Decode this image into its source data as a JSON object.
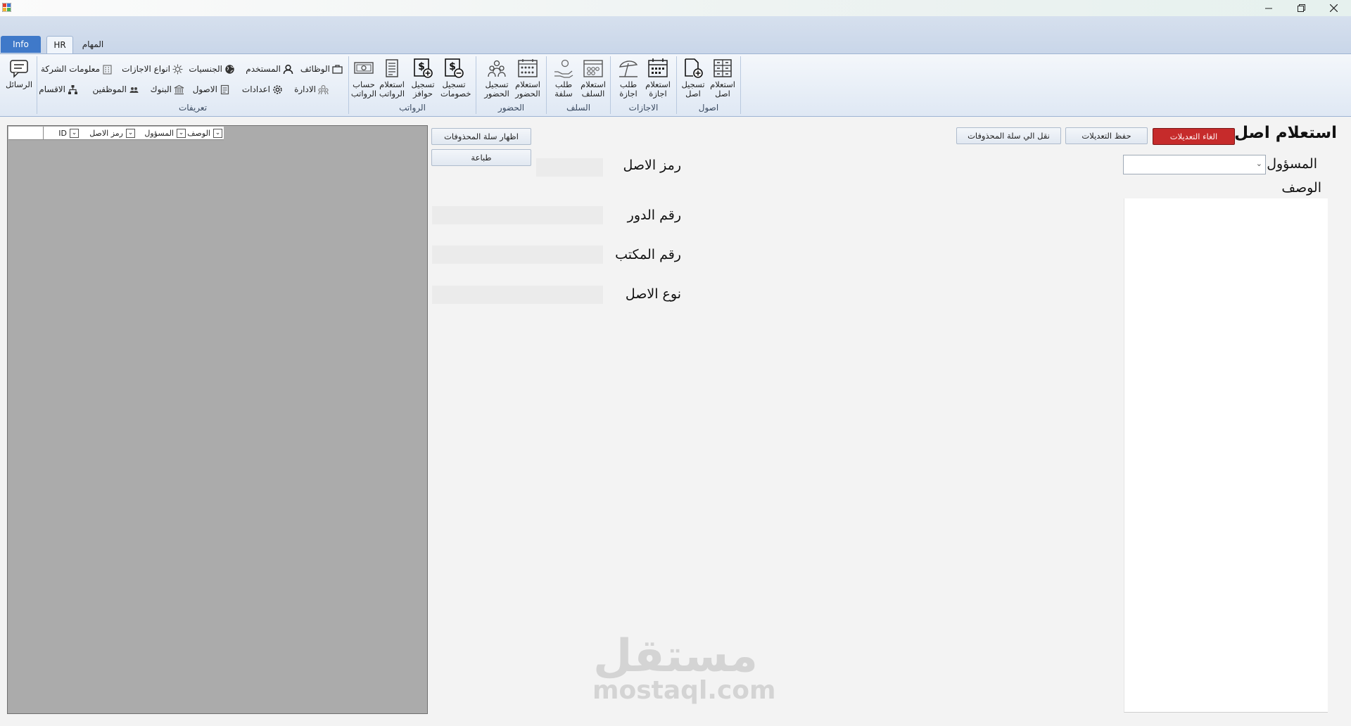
{
  "ribbon": {
    "tabs": [
      {
        "label": "Info"
      },
      {
        "label": "HR"
      },
      {
        "label": "المهام"
      }
    ],
    "groups": {
      "assets": {
        "label": "اصول",
        "buttons": [
          {
            "label": "استعلام\nاصل"
          },
          {
            "label": "تسجيل\nاصل"
          }
        ]
      },
      "leaves": {
        "label": "الاجازات",
        "buttons": [
          {
            "label": "استعلام\nاجازة"
          },
          {
            "label": "طلب\nاجازة"
          }
        ]
      },
      "advances": {
        "label": "السلف",
        "buttons": [
          {
            "label": "استعلام\nالسلف"
          },
          {
            "label": "طلب\nسلفة"
          }
        ]
      },
      "attendance": {
        "label": "الحضور",
        "buttons": [
          {
            "label": "استعلام\nالحضور"
          },
          {
            "label": "تسجيل\nالحضور"
          }
        ]
      },
      "salaries": {
        "label": "الرواتب",
        "buttons": [
          {
            "label": "تسجيل\nخصومات"
          },
          {
            "label": "تسجيل\nحوافز"
          },
          {
            "label": "استعلام\nالرواتب"
          },
          {
            "label": "حساب\nالرواتب"
          }
        ]
      },
      "definitions": {
        "label": "تعريفات",
        "row1": [
          {
            "label": "الوظائف"
          },
          {
            "label": "المستخدم"
          },
          {
            "label": "الجنسيات"
          },
          {
            "label": "انواع الاجازات"
          },
          {
            "label": "معلومات الشركة"
          }
        ],
        "row2": [
          {
            "label": "الادارة"
          },
          {
            "label": "اعدادات"
          },
          {
            "label": "الاصول"
          },
          {
            "label": "البنوك"
          },
          {
            "label": "الموظفين"
          },
          {
            "label": "الاقسام"
          }
        ]
      },
      "messages": {
        "label": "الرسائل"
      }
    }
  },
  "form": {
    "title": "استعلام اصل",
    "cancel_label": "الغاء التعديلات",
    "save_label": "حفظ التعديلات",
    "move_to_trash_label": "نقل الي سلة المحذوفات",
    "show_trash_label": "اظهار سلة المحذوفات",
    "print_label": "طباعة",
    "responsible_label": "المسؤول",
    "responsible_value": "",
    "description_label": "الوصف",
    "description_value": "",
    "asset_code_label": "رمز الاصل",
    "asset_code_value": "",
    "floor_label": "رقم الدور",
    "floor_value": "",
    "office_label": "رقم المكتب",
    "office_value": "",
    "asset_type_label": "نوع الاصل",
    "asset_type_value": ""
  },
  "grid": {
    "columns": [
      {
        "label": "الوصف"
      },
      {
        "label": "المسؤول"
      },
      {
        "label": "رمز الاصل"
      },
      {
        "label": "ID"
      }
    ],
    "rows": []
  },
  "watermark": {
    "arabic": "مستقل",
    "latin": "mostaql.com"
  }
}
